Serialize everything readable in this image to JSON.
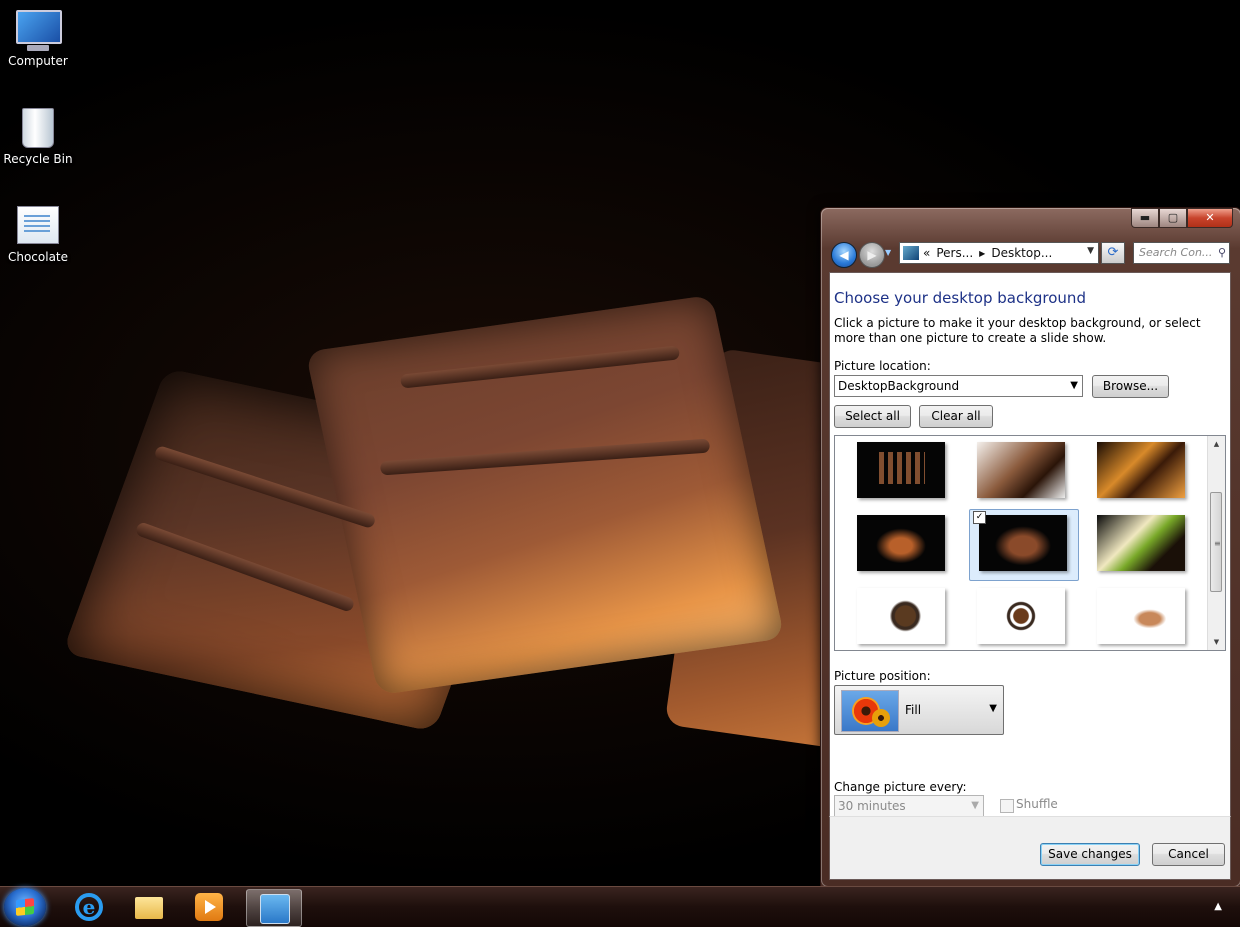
{
  "desktop": {
    "icons": [
      {
        "label": "Computer"
      },
      {
        "label": "Recycle Bin"
      },
      {
        "label": "Chocolate"
      }
    ]
  },
  "window": {
    "caption_buttons": {
      "minimize": "▬",
      "maximize": "▢",
      "close": "✕"
    },
    "nav": {
      "back": "◀",
      "forward": "▶",
      "address_prefix": "«",
      "breadcrumbs": [
        "Pers...",
        "Desktop..."
      ],
      "search_placeholder": "Search Con..."
    },
    "title": "Choose your desktop background",
    "description": "Click a picture to make it your desktop background, or select more than one picture to create a slide show.",
    "picture_location_label": "Picture location:",
    "picture_location_value": "DesktopBackground",
    "browse_label": "Browse...",
    "select_all_label": "Select all",
    "clear_all_label": "Clear all",
    "thumbnails": [
      {
        "row": 0,
        "col": 0,
        "selected": false
      },
      {
        "row": 0,
        "col": 1,
        "selected": false
      },
      {
        "row": 0,
        "col": 2,
        "selected": false
      },
      {
        "row": 1,
        "col": 0,
        "selected": false
      },
      {
        "row": 1,
        "col": 1,
        "selected": true
      },
      {
        "row": 1,
        "col": 2,
        "selected": false
      },
      {
        "row": 2,
        "col": 0,
        "selected": false
      },
      {
        "row": 2,
        "col": 1,
        "selected": false
      },
      {
        "row": 2,
        "col": 2,
        "selected": false
      }
    ],
    "picture_position_label": "Picture position:",
    "picture_position_value": "Fill",
    "change_every_label": "Change picture every:",
    "change_every_value": "30 minutes",
    "shuffle_label": "Shuffle",
    "save_label": "Save changes",
    "cancel_label": "Cancel"
  },
  "colors": {
    "title_blue": "#1e3287",
    "window_frame": "#5a3a30",
    "taskbar": "#1e0f0c"
  }
}
